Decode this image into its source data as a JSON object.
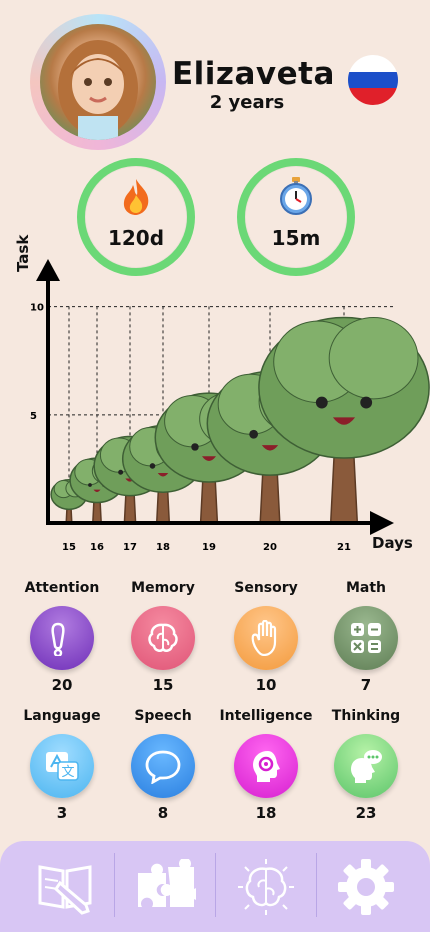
{
  "profile": {
    "name": "Elizaveta",
    "age": "2 years",
    "flag_icon": "russia-flag-icon"
  },
  "stats": [
    {
      "icon": "fire-icon",
      "value": "120d",
      "ring_color": "#6bd876"
    },
    {
      "icon": "stopwatch-icon",
      "value": "15m",
      "ring_color": "#6bd876"
    }
  ],
  "chart_data": {
    "type": "bar",
    "ylabel": "Task",
    "xlabel": "Days",
    "y_ticks": [
      5,
      10
    ],
    "categories": [
      "15",
      "16",
      "17",
      "18",
      "19",
      "20",
      "21"
    ],
    "values": [
      2,
      3,
      4,
      4.5,
      6,
      7,
      9.5
    ],
    "ylim": [
      0,
      11
    ],
    "marker": "tree",
    "grid": "dashed"
  },
  "categories": [
    {
      "label": "Attention",
      "count": "20",
      "icon": "exclamation-icon",
      "color_a": "#b07be0",
      "color_b": "#6f2fb8"
    },
    {
      "label": "Memory",
      "count": "15",
      "icon": "brain-icon",
      "color_a": "#f58aa0",
      "color_b": "#e05577"
    },
    {
      "label": "Sensory",
      "count": "10",
      "icon": "hand-icon",
      "color_a": "#ffc68a",
      "color_b": "#f39a3c"
    },
    {
      "label": "Math",
      "count": "7",
      "icon": "calculator-icon",
      "color_a": "#9ab88f",
      "color_b": "#5f7e55"
    },
    {
      "label": "Language",
      "count": "3",
      "icon": "translate-icon",
      "color_a": "#9fdcff",
      "color_b": "#4cb5f0"
    },
    {
      "label": "Speech",
      "count": "8",
      "icon": "speech-bubble-icon",
      "color_a": "#69b8ff",
      "color_b": "#2a7fe0"
    },
    {
      "label": "Intelligence",
      "count": "18",
      "icon": "head-gear-icon",
      "color_a": "#ff66f0",
      "color_b": "#d61fd0"
    },
    {
      "label": "Thinking",
      "count": "23",
      "icon": "thinking-head-icon",
      "color_a": "#b6f2a7",
      "color_b": "#5cc56a"
    }
  ],
  "nav": [
    {
      "icon": "book-pencil-icon"
    },
    {
      "icon": "puzzle-icon"
    },
    {
      "icon": "brain-outline-icon"
    },
    {
      "icon": "gear-icon"
    }
  ]
}
